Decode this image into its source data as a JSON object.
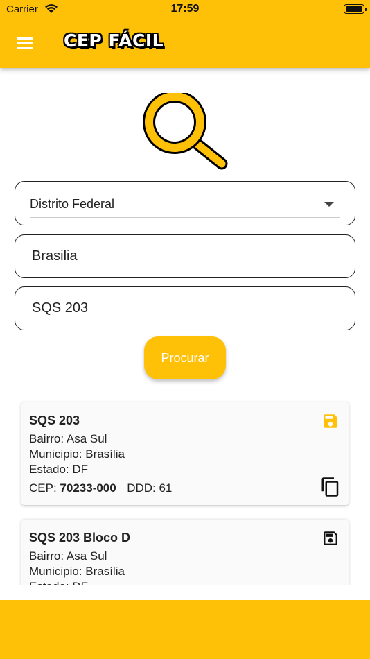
{
  "status_bar": {
    "carrier": "Carrier",
    "time": "17:59"
  },
  "app_bar": {
    "title": "CEP FÁCIL"
  },
  "form": {
    "state_value": "Distrito Federal",
    "city_value": "Brasilia",
    "street_value": "SQS 203",
    "search_label": "Procurar"
  },
  "colors": {
    "accent": "#FFC107",
    "text": "#222222",
    "card_bg": "#FAFAFA"
  },
  "results": [
    {
      "title": "SQS 203",
      "bairro": "Bairro: Asa Sul",
      "municipio": "Municipio: Brasília",
      "estado": "Estado: DF",
      "cep_label": "CEP:",
      "cep": "70233-000",
      "ddd": "DDD: 61",
      "save_icon": "save-icon",
      "saved": true
    },
    {
      "title": "SQS 203 Bloco D",
      "bairro": "Bairro: Asa Sul",
      "municipio": "Municipio: Brasília",
      "estado": "Estado: DF",
      "save_icon": "save-icon",
      "saved": false
    }
  ]
}
